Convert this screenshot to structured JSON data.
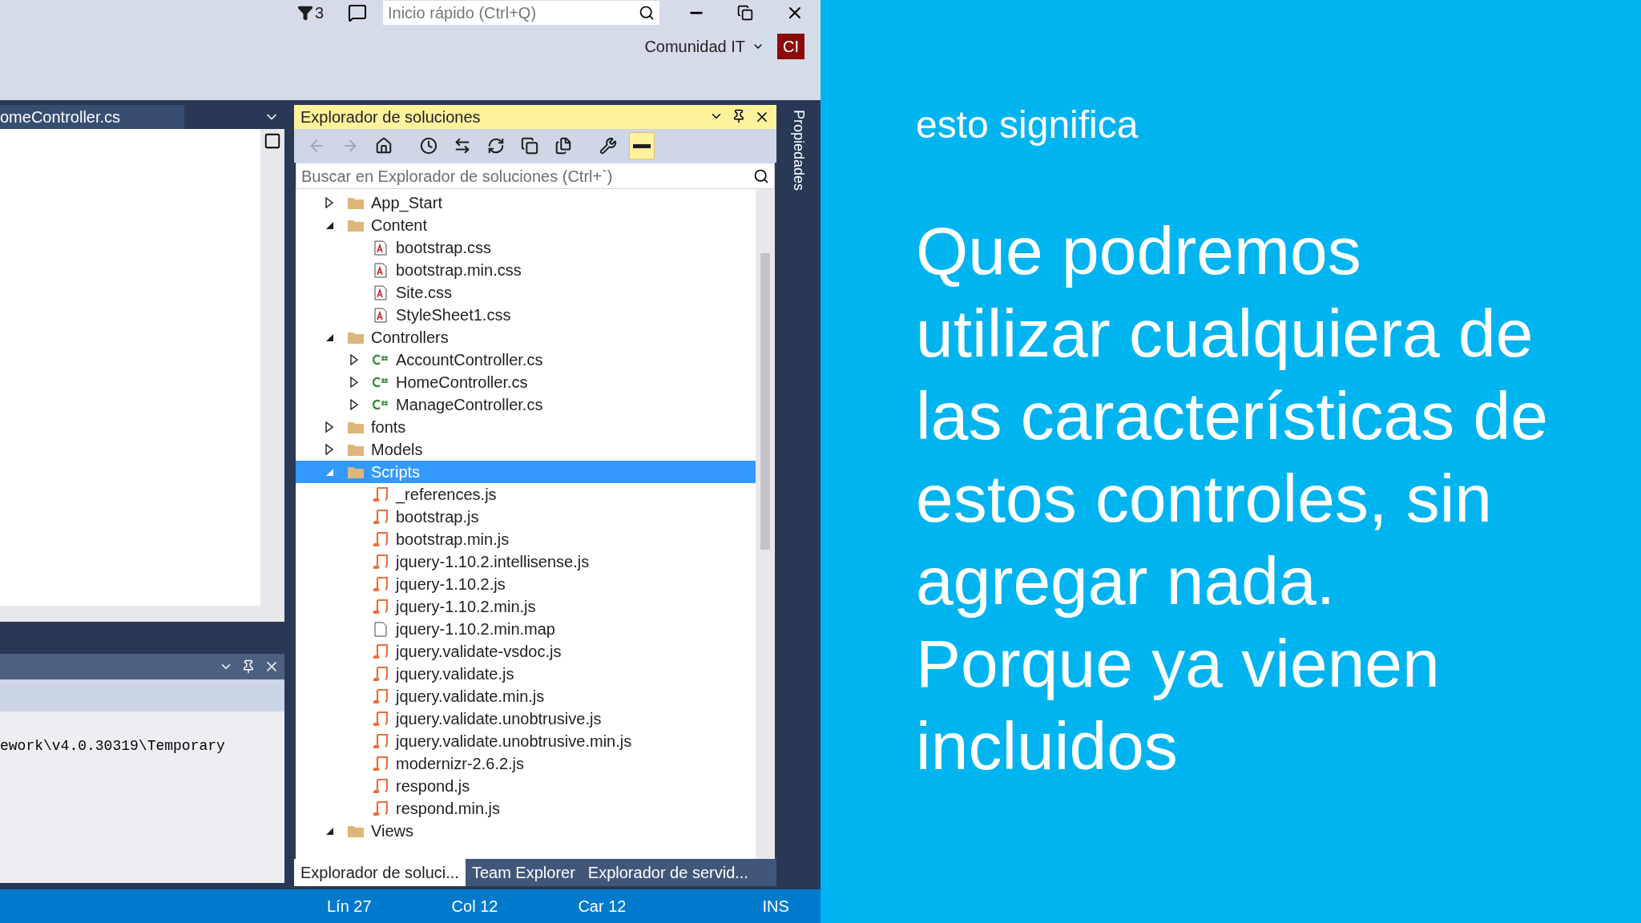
{
  "top_bar": {
    "notifications": "3",
    "quick_launch": {
      "placeholder": "Inicio rápido (Ctrl+Q)"
    },
    "account": {
      "name": "Comunidad IT",
      "initials": "CI"
    }
  },
  "editor": {
    "tab": "omeController.cs"
  },
  "output_panel": {
    "line": "ework\\v4.0.30319\\Temporary"
  },
  "solution_explorer": {
    "title": "Explorador de soluciones",
    "toolbar": [
      {
        "kind": "back",
        "disabled": true,
        "on": false
      },
      {
        "kind": "forward",
        "disabled": true,
        "on": false
      },
      {
        "kind": "home",
        "disabled": false,
        "on": false
      },
      {
        "kind": "history",
        "disabled": false,
        "on": false
      },
      {
        "kind": "sync",
        "disabled": false,
        "on": false
      },
      {
        "kind": "refresh",
        "disabled": false,
        "on": false
      },
      {
        "kind": "collapse",
        "disabled": false,
        "on": false
      },
      {
        "kind": "showall",
        "disabled": false,
        "on": false
      },
      {
        "kind": "properties",
        "disabled": false,
        "on": false
      },
      {
        "kind": "preview",
        "disabled": false,
        "on": true
      }
    ],
    "search": {
      "placeholder": "Buscar en Explorador de soluciones (Ctrl+`)"
    },
    "tree": [
      {
        "name": "App_Start",
        "kind": "folder",
        "expanded": false,
        "selected": false
      },
      {
        "name": "Content",
        "kind": "folder",
        "expanded": true,
        "selected": false,
        "children": [
          {
            "name": "bootstrap.css",
            "kind": "css",
            "selected": false
          },
          {
            "name": "bootstrap.min.css",
            "kind": "css",
            "selected": false
          },
          {
            "name": "Site.css",
            "kind": "css",
            "selected": false
          },
          {
            "name": "StyleSheet1.css",
            "kind": "css",
            "selected": false
          }
        ]
      },
      {
        "name": "Controllers",
        "kind": "folder",
        "expanded": true,
        "selected": false,
        "children": [
          {
            "name": "AccountController.cs",
            "kind": "cs",
            "expanded": false,
            "selected": false
          },
          {
            "name": "HomeController.cs",
            "kind": "cs",
            "expanded": false,
            "selected": false
          },
          {
            "name": "ManageController.cs",
            "kind": "cs",
            "expanded": false,
            "selected": false
          }
        ]
      },
      {
        "name": "fonts",
        "kind": "folder",
        "expanded": false,
        "selected": false
      },
      {
        "name": "Models",
        "kind": "folder",
        "expanded": false,
        "selected": false
      },
      {
        "name": "Scripts",
        "kind": "folder",
        "expanded": true,
        "selected": true,
        "children": [
          {
            "name": "_references.js",
            "kind": "js",
            "selected": false
          },
          {
            "name": "bootstrap.js",
            "kind": "js",
            "selected": false
          },
          {
            "name": "bootstrap.min.js",
            "kind": "js",
            "selected": false
          },
          {
            "name": "jquery-1.10.2.intellisense.js",
            "kind": "js",
            "selected": false
          },
          {
            "name": "jquery-1.10.2.js",
            "kind": "js",
            "selected": false
          },
          {
            "name": "jquery-1.10.2.min.js",
            "kind": "js",
            "selected": false
          },
          {
            "name": "jquery-1.10.2.min.map",
            "kind": "file",
            "selected": false
          },
          {
            "name": "jquery.validate-vsdoc.js",
            "kind": "js",
            "selected": false
          },
          {
            "name": "jquery.validate.js",
            "kind": "js",
            "selected": false
          },
          {
            "name": "jquery.validate.min.js",
            "kind": "js",
            "selected": false
          },
          {
            "name": "jquery.validate.unobtrusive.js",
            "kind": "js",
            "selected": false
          },
          {
            "name": "jquery.validate.unobtrusive.min.js",
            "kind": "js",
            "selected": false
          },
          {
            "name": "modernizr-2.6.2.js",
            "kind": "js",
            "selected": false
          },
          {
            "name": "respond.js",
            "kind": "js",
            "selected": false
          },
          {
            "name": "respond.min.js",
            "kind": "js",
            "selected": false
          }
        ]
      },
      {
        "name": "Views",
        "kind": "folder",
        "expanded": true,
        "selected": false
      }
    ],
    "tabs": [
      {
        "label": "Explorador de soluci...",
        "selected": true
      },
      {
        "label": "Team Explorer",
        "selected": false
      },
      {
        "label": "Explorador de servid...",
        "selected": false
      }
    ]
  },
  "side_tab": "Propiedades",
  "status_bar": [
    "Lín 27",
    "Col 12",
    "Car 12",
    "INS"
  ],
  "caption": {
    "heading": "esto significa",
    "lines": [
      "Que podremos",
      "utilizar cualquiera de",
      "las características de",
      "estos controles, sin",
      "agregar nada.",
      "Porque ya vienen",
      "incluidos"
    ]
  }
}
